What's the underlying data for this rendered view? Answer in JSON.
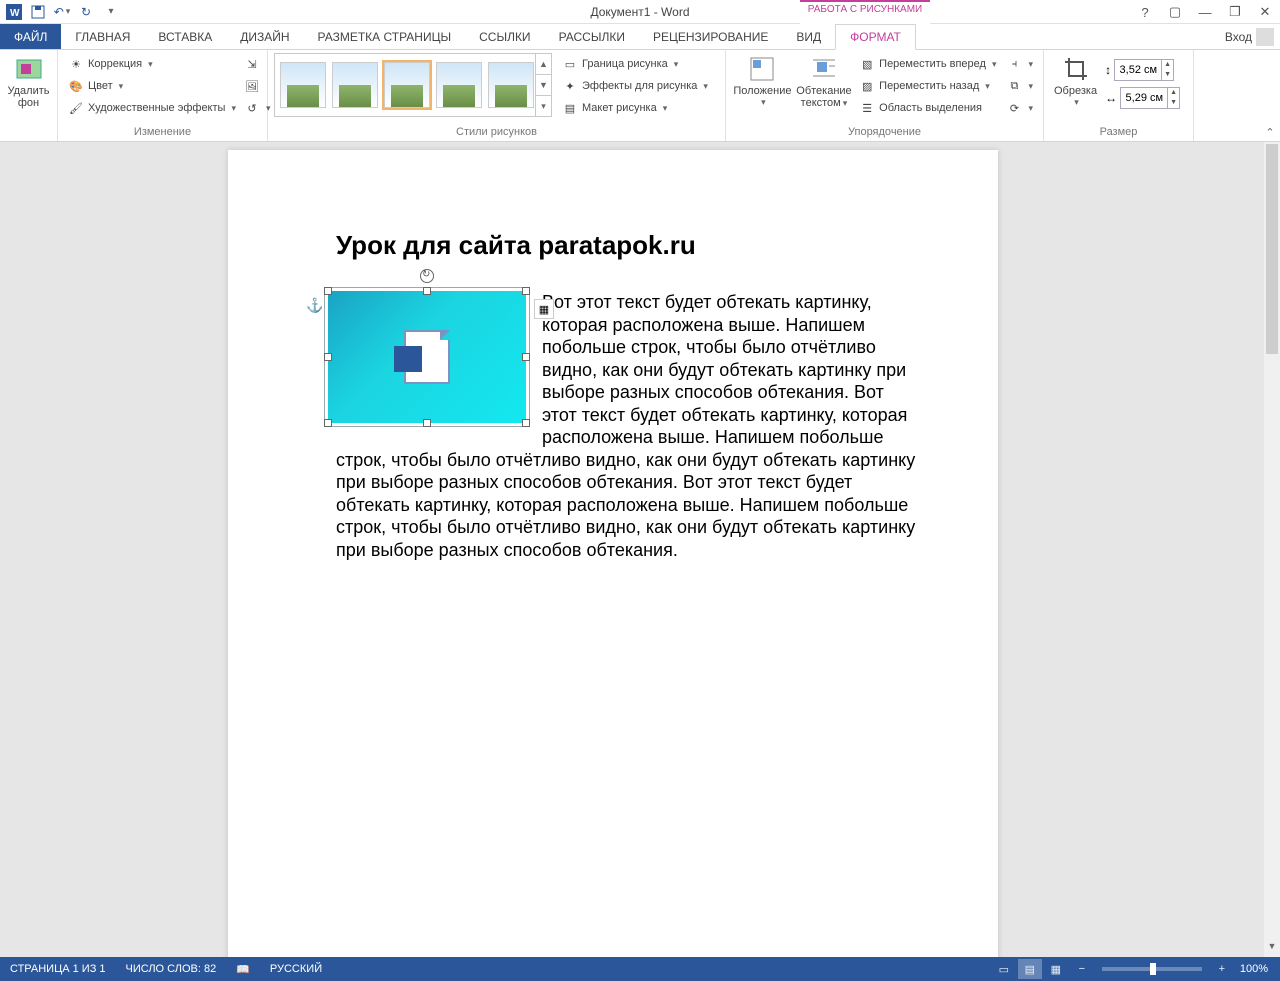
{
  "title": "Документ1 - Word",
  "contextual_tab_label": "РАБОТА С РИСУНКАМИ",
  "signin_label": "Вход",
  "tabs": {
    "file": "ФАЙЛ",
    "home": "ГЛАВНАЯ",
    "insert": "ВСТАВКА",
    "design": "ДИЗАЙН",
    "layout": "РАЗМЕТКА СТРАНИЦЫ",
    "references": "ССЫЛКИ",
    "mailings": "РАССЫЛКИ",
    "review": "РЕЦЕНЗИРОВАНИЕ",
    "view": "ВИД",
    "format": "ФОРМАТ"
  },
  "ribbon": {
    "remove_bg_top": "Удалить",
    "remove_bg_bot": "фон",
    "corrections": "Коррекция",
    "color": "Цвет",
    "artistic": "Художественные эффекты",
    "group_adjust": "Изменение",
    "group_styles": "Стили рисунков",
    "pic_border": "Граница рисунка",
    "pic_effects": "Эффекты для рисунка",
    "pic_layout": "Макет рисунка",
    "position": "Положение",
    "wrap_top": "Обтекание",
    "wrap_bot": "текстом",
    "bring_forward": "Переместить вперед",
    "send_backward": "Переместить назад",
    "selection_pane": "Область выделения",
    "group_arrange": "Упорядочение",
    "crop": "Обрезка",
    "group_size": "Размер",
    "height": "3,52 см",
    "width": "5,29 см"
  },
  "document": {
    "heading": "Урок для сайта paratapok.ru",
    "body": "Вот этот текст будет обтекать картинку, которая расположена выше. Напишем побольше строк, чтобы было отчётливо видно, как они будут обтекать картинку при выборе разных способов обтекания. Вот этот текст будет обтекать картинку, которая расположена выше. Напишем побольше строк, чтобы было отчётливо видно, как они будут обтекать картинку при выборе разных способов обтекания. Вот этот текст будет обтекать картинку, которая расположена выше. Напишем побольше строк, чтобы было отчётливо видно, как они будут обтекать картинку при выборе разных способов обтекания."
  },
  "status": {
    "page": "СТРАНИЦА 1 ИЗ 1",
    "words": "ЧИСЛО СЛОВ: 82",
    "language": "РУССКИЙ",
    "zoom": "100%"
  }
}
